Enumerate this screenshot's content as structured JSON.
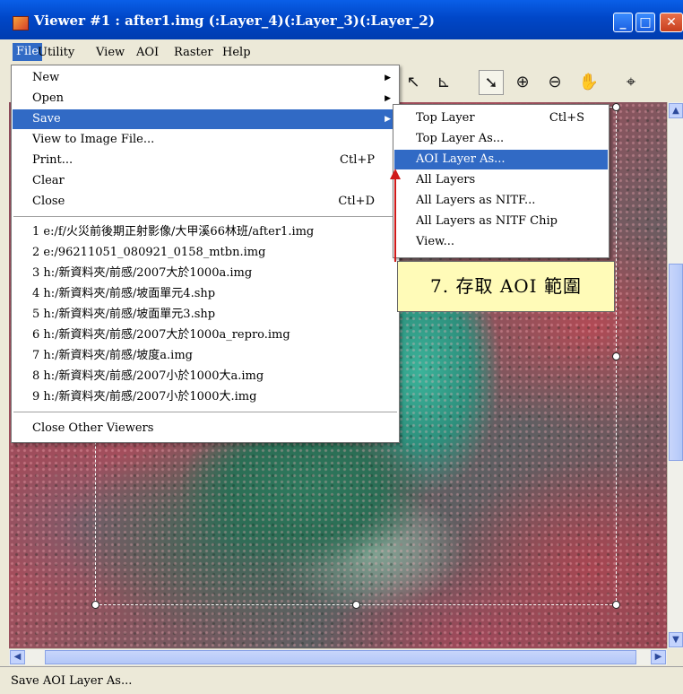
{
  "window": {
    "title": "Viewer #1 : after1.img (:Layer_4)(:Layer_3)(:Layer_2)"
  },
  "menubar": {
    "items": [
      "File",
      "Utility",
      "View",
      "AOI",
      "Raster",
      "Help"
    ]
  },
  "file_menu": {
    "items": [
      {
        "label": "New",
        "submenu": true
      },
      {
        "label": "Open",
        "submenu": true
      },
      {
        "label": "Save",
        "submenu": true,
        "highlighted": true
      },
      {
        "label": "View to Image File..."
      },
      {
        "label": "Print...",
        "shortcut": "Ctl+P"
      },
      {
        "label": "Clear"
      },
      {
        "label": "Close",
        "shortcut": "Ctl+D"
      }
    ],
    "recent_files": [
      "1 e:/f/火災前後期正射影像/大甲溪66林班/after1.img",
      "2 e:/96211051_080921_0158_mtbn.img",
      "3 h:/新資料夾/前感/2007大於1000a.img",
      "4 h:/新資料夾/前感/坡面單元4.shp",
      "5 h:/新資料夾/前感/坡面單元3.shp",
      "6 h:/新資料夾/前感/2007大於1000a_repro.img",
      "7 h:/新資料夾/前感/坡度a.img",
      "8 h:/新資料夾/前感/2007小於1000大a.img",
      "9 h:/新資料夾/前感/2007小於1000大.img"
    ],
    "close_others": "Close Other Viewers"
  },
  "save_submenu": {
    "items": [
      {
        "label": "Top Layer",
        "shortcut": "Ctl+S"
      },
      {
        "label": "Top Layer As..."
      },
      {
        "label": "AOI Layer As...",
        "highlighted": true
      },
      {
        "label": "All Layers"
      },
      {
        "label": "All Layers as NITF..."
      },
      {
        "label": "All Layers as NITF Chip"
      },
      {
        "label": "View..."
      }
    ]
  },
  "callout": {
    "text": "7. 存取 AOI 範圍"
  },
  "statusbar": {
    "text": "Save AOI Layer As..."
  },
  "colors": {
    "titlebar": "#0a5fe8",
    "menu_highlight": "#316ac5",
    "callout_bg": "#fffbb8",
    "arrow": "#d01a1a"
  }
}
